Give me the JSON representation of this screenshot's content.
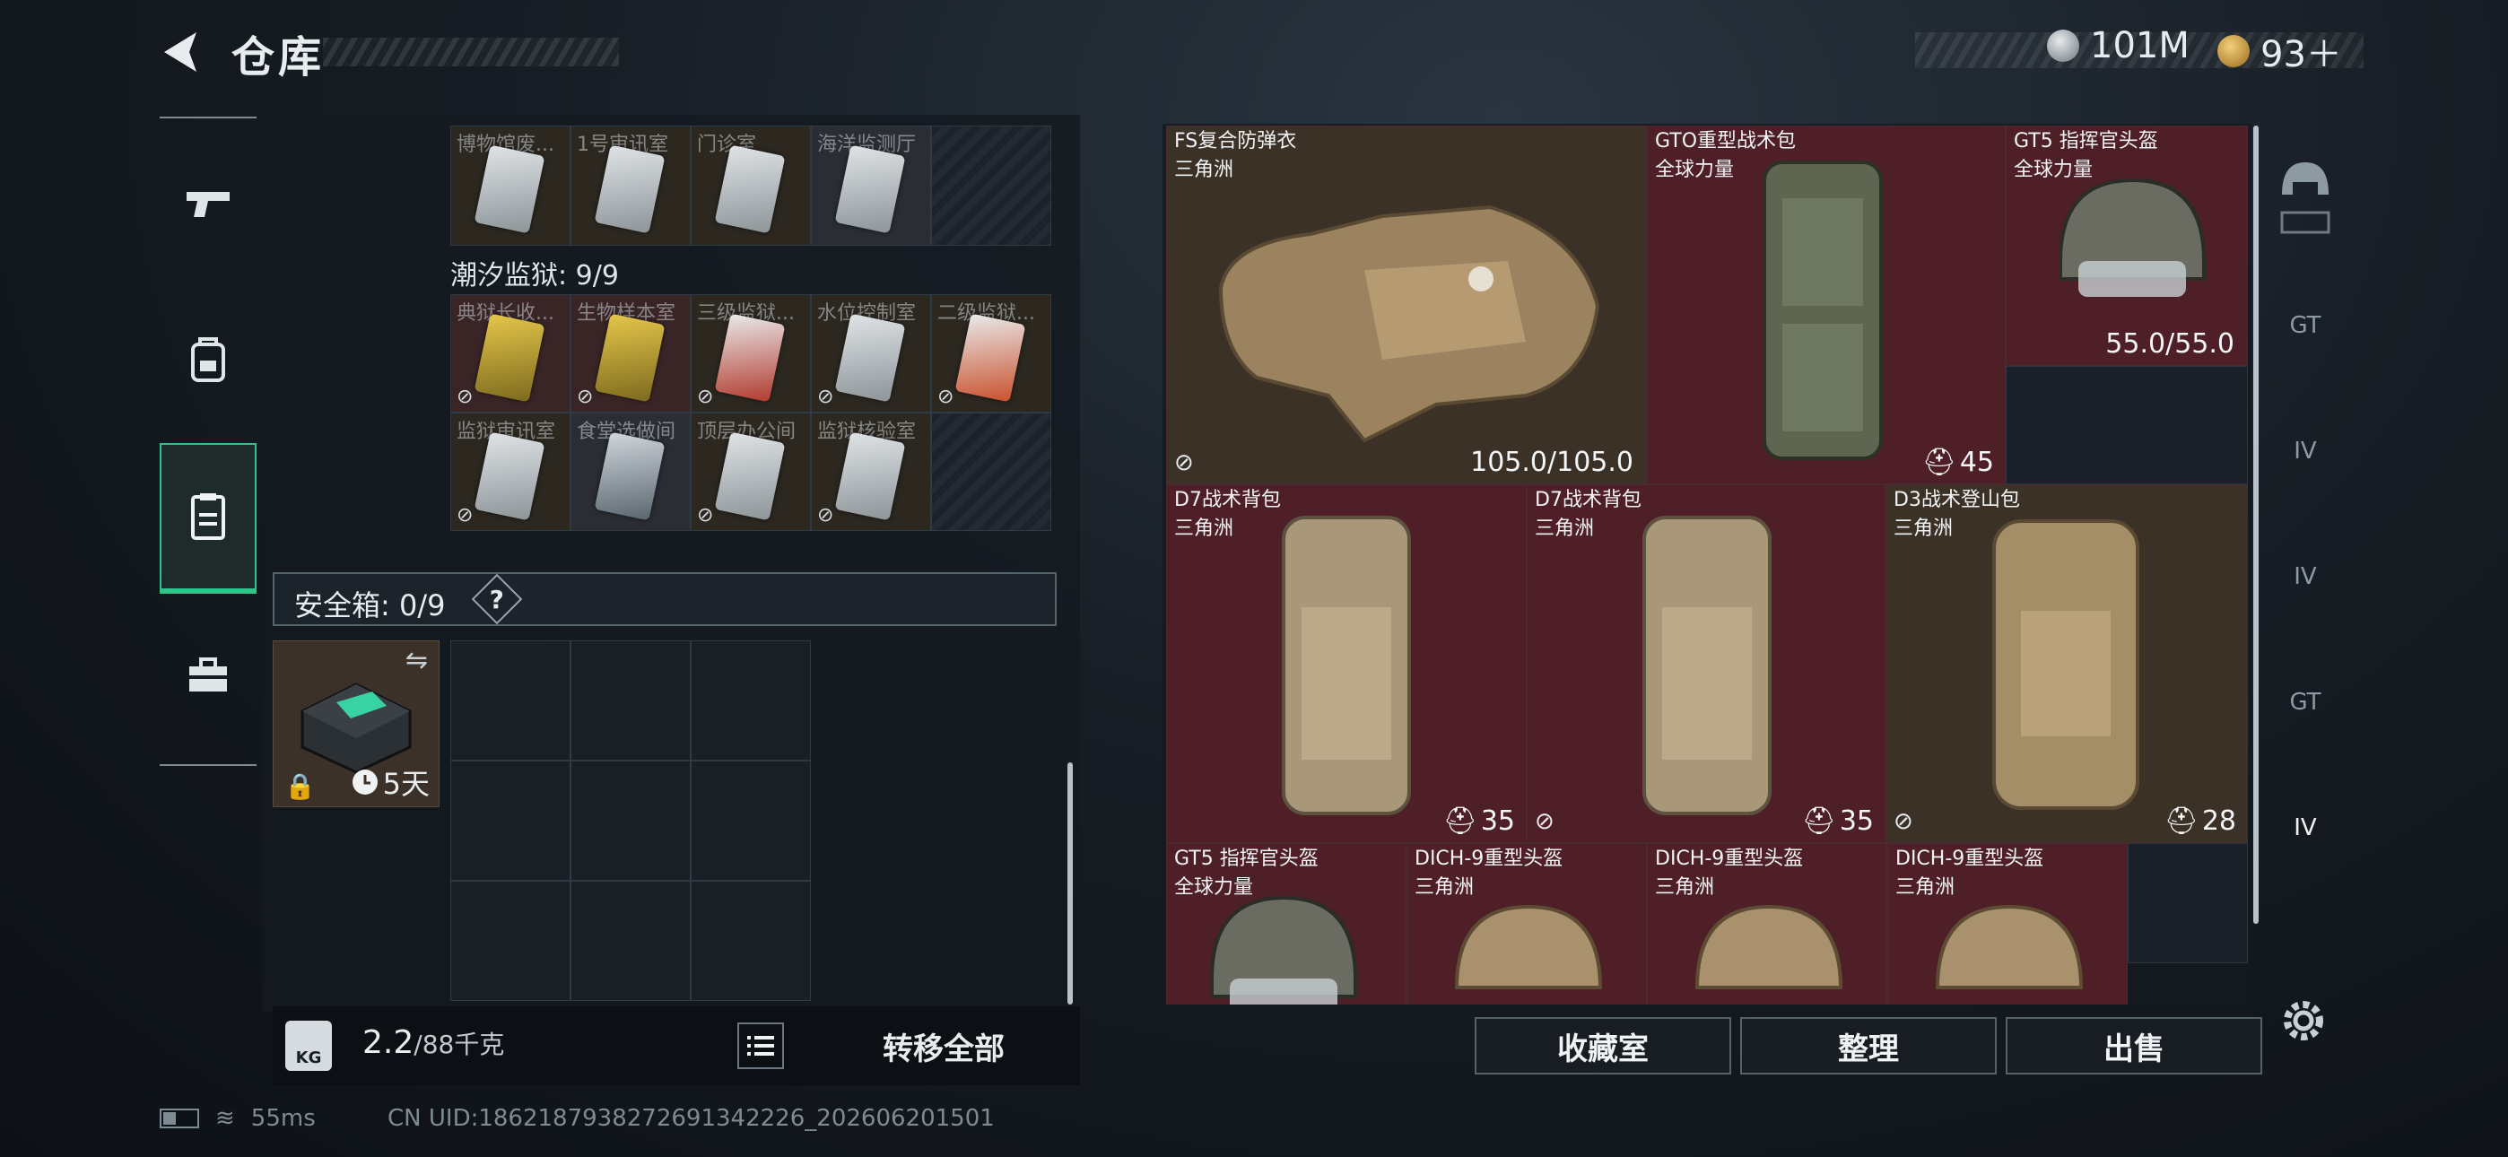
{
  "header": {
    "title": "仓库",
    "currencies": [
      {
        "icon": "silver-coin-icon",
        "value": "101M"
      },
      {
        "icon": "gold-triangle-coin-icon",
        "value": "93＋"
      }
    ]
  },
  "left_nav": [
    "pistol-icon",
    "backpack-icon",
    "clipboard-icon",
    "toolbox-icon"
  ],
  "keycards_top": [
    "博物馆废...",
    "1号审讯室",
    "门诊室",
    "海洋监测厅"
  ],
  "prison_section": {
    "label": "潮汐监狱: 9/9",
    "cards": [
      "典狱长收...",
      "生物样本室",
      "三级监狱...",
      "水位控制室",
      "二级监狱...",
      "监狱审讯室",
      "食堂选做间",
      "顶层办公间",
      "监狱核验室"
    ]
  },
  "safebox": {
    "label": "安全箱: 0/9",
    "help": "?",
    "item_timer": "5天"
  },
  "weight": {
    "current": "2.2",
    "max": "/88千克"
  },
  "transfer_all_label": "转移全部",
  "items": [
    {
      "name": "FS复合防弹衣",
      "source": "三角洲",
      "durability": "105.0/105.0"
    },
    {
      "name": "GTO重型战术包",
      "source": "全球力量",
      "capacity": "45"
    },
    {
      "name": "GT5 指挥官头盔",
      "source": "全球力量",
      "durability": "55.0/55.0"
    },
    {
      "name": "D7战术背包",
      "source": "三角洲",
      "capacity": "35"
    },
    {
      "name": "D7战术背包",
      "source": "三角洲",
      "capacity": "35"
    },
    {
      "name": "D3战术登山包",
      "source": "三角洲",
      "capacity": "28"
    },
    {
      "name": "GT5 指挥官头盔",
      "source": "全球力量"
    },
    {
      "name": "DICH-9重型头盔",
      "source": "三角洲"
    },
    {
      "name": "DICH-9重型头盔",
      "source": "三角洲"
    },
    {
      "name": "DICH-9重型头盔",
      "source": "三角洲"
    }
  ],
  "right_nav": [
    {
      "icon": "helmet-icon",
      "label": ""
    },
    {
      "icon": "armor-icon",
      "label": ""
    },
    {
      "icon": "gt-armor-icon",
      "label": "GT"
    },
    {
      "icon": "iv-medkit-icon",
      "label": "IV"
    },
    {
      "icon": "iv-medkit-plus-icon",
      "label": "IV"
    },
    {
      "icon": "gt-box-icon",
      "label": "GT"
    },
    {
      "icon": "iv-box-icon",
      "label": "IV"
    }
  ],
  "buttons": {
    "collection": "收藏室",
    "organize": "整理",
    "sell": "出售"
  },
  "footer": {
    "ping": "55ms",
    "uid": "CN UID:1862187938272691342226_202606201501"
  },
  "colors": {
    "accent": "#30c48a",
    "item_red": "#4e1f27",
    "item_brown": "#3b3127"
  }
}
